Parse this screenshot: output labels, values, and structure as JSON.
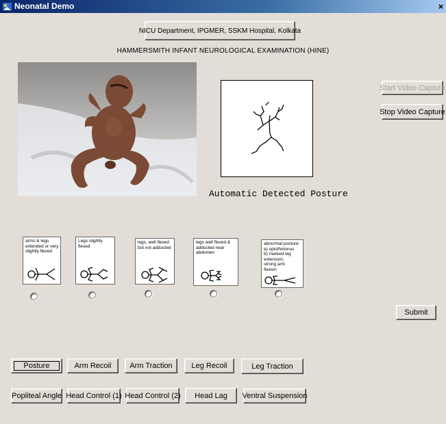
{
  "window": {
    "title": "Neonatal Demo",
    "close_glyph": "×"
  },
  "header": {
    "department_button": "NICU Department, IPGMER, SSKM Hospital, Kolkata",
    "exam_title": "HAMMERSMITH INFANT NEUROLOGICAL EXAMINATION (HINE)"
  },
  "capture": {
    "start_label": "Start Video Capture",
    "stop_label": "Stop Video Capture"
  },
  "detection": {
    "label": "Automatic Detected Posture"
  },
  "posture_options": [
    {
      "text": "arms & legs\nextended or very\nslightly flexed"
    },
    {
      "text": "Legs slightly flexed"
    },
    {
      "text": "legs, well flexed\nbut not adducted"
    },
    {
      "text": "legs well flexed &\nadducted near\nabdomen"
    },
    {
      "text": "abnormal posture:\na)  opisthotonus\nb)  marked leg\n     extension,\n     strong arm\n     flexion"
    }
  ],
  "submit_label": "Submit",
  "tests_row1": [
    "Posture",
    "Arm Recoil",
    "Arm Traction",
    "Leg Recoil",
    "Leg Traction"
  ],
  "tests_row2": [
    "Popliteal Angle",
    "Head Control (1)",
    "Head Control (2)",
    "Head Lag",
    "Ventral Suspension"
  ],
  "colors": {
    "titlebar_start": "#0a246a",
    "titlebar_end": "#a6caf0",
    "window_bg": "#e2ddd6"
  }
}
